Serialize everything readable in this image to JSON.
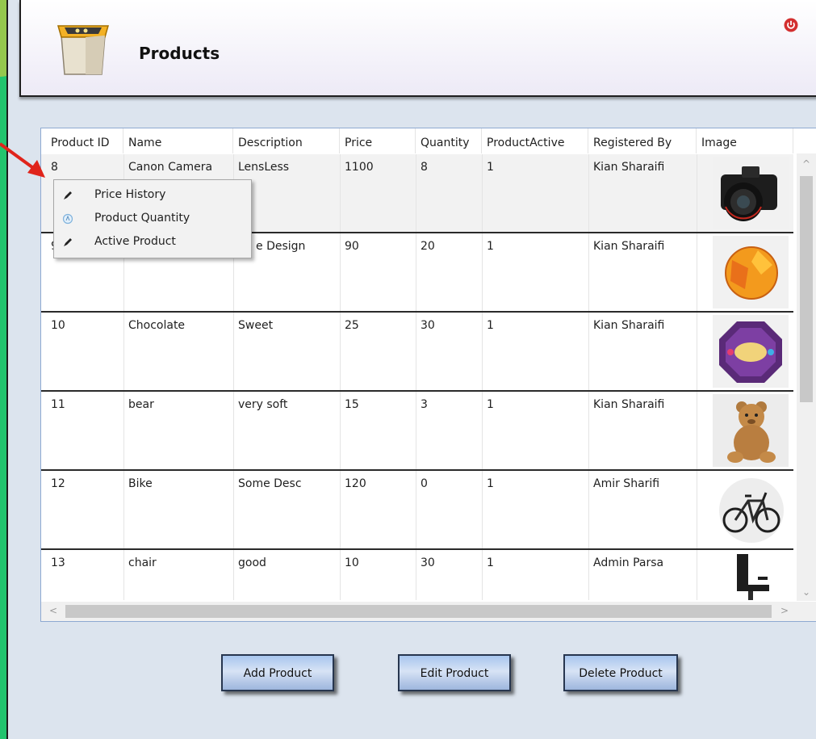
{
  "header": {
    "title": "Products",
    "icon": "box-icon",
    "power_icon": "power-icon",
    "accent": "#d32f2f"
  },
  "table": {
    "columns": [
      "Product ID",
      "Name",
      "Description",
      "Price",
      "Quantity",
      "ProductActive",
      "Registered By",
      "Image"
    ],
    "rows": [
      {
        "id": "8",
        "name": "Canon Camera",
        "description": "LensLess",
        "price": "1100",
        "quantity": "8",
        "active": "1",
        "registered_by": "Kian Sharaifi",
        "image": "camera-image"
      },
      {
        "id": "9",
        "name": "",
        "description": "e Design",
        "price": "90",
        "quantity": "20",
        "active": "1",
        "registered_by": "Kian Sharaifi",
        "image": "ball-image"
      },
      {
        "id": "10",
        "name": "Chocolate",
        "description": "Sweet",
        "price": "25",
        "quantity": "30",
        "active": "1",
        "registered_by": "Kian Sharaifi",
        "image": "chocolate-tin-image"
      },
      {
        "id": "11",
        "name": "bear",
        "description": "very soft",
        "price": "15",
        "quantity": "3",
        "active": "1",
        "registered_by": "Kian Sharaifi",
        "image": "teddy-bear-image"
      },
      {
        "id": "12",
        "name": "Bike",
        "description": "Some Desc",
        "price": "120",
        "quantity": "0",
        "active": "1",
        "registered_by": "Amir Sharifi",
        "image": "bicycle-image"
      },
      {
        "id": "13",
        "name": "chair",
        "description": "good",
        "price": "10",
        "quantity": "30",
        "active": "1",
        "registered_by": "Admin Parsa",
        "image": "office-chair-image"
      }
    ]
  },
  "context_menu": {
    "items": [
      {
        "label": "Price History",
        "icon": "pen-icon"
      },
      {
        "label": "Product Quantity",
        "icon": "circle-icon"
      },
      {
        "label": "Active Product",
        "icon": "pen-icon"
      }
    ]
  },
  "buttons": {
    "add": "Add Product",
    "edit": "Edit Product",
    "delete": "Delete Product"
  },
  "colors": {
    "frame": "#22c46e",
    "annotation_arrow": "#e0241b"
  }
}
